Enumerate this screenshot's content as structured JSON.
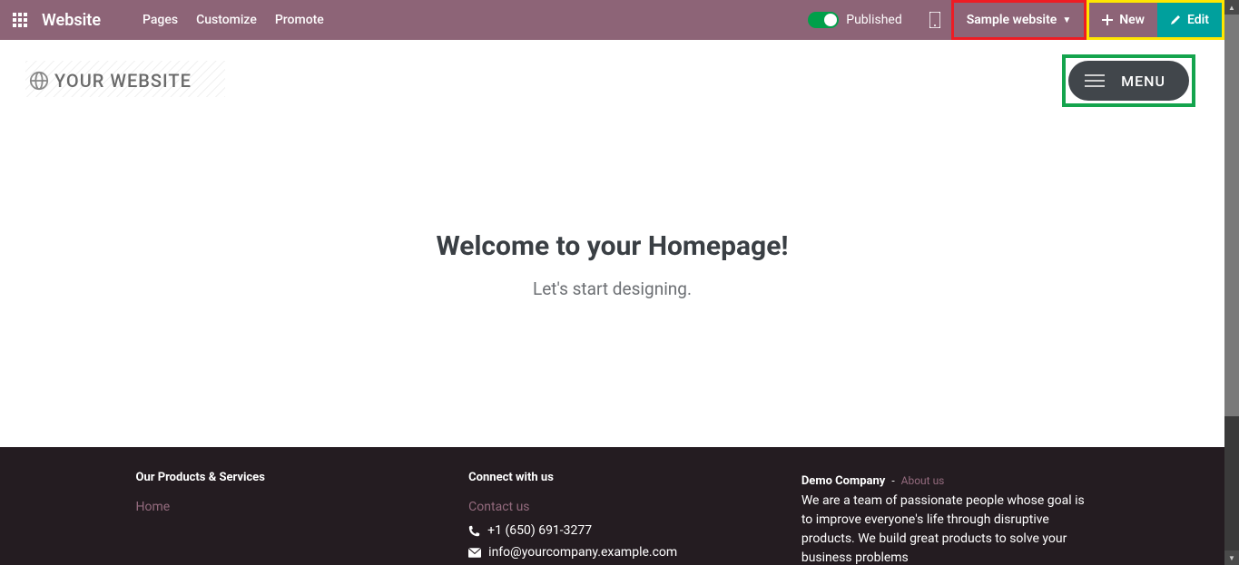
{
  "topbar": {
    "brand": "Website",
    "links": {
      "pages": "Pages",
      "customize": "Customize",
      "promote": "Promote"
    },
    "published_label": "Published",
    "site_switcher": "Sample website",
    "new_label": "New",
    "edit_label": "Edit"
  },
  "header": {
    "logo_text": "YOUR WEBSITE",
    "menu_label": "MENU"
  },
  "hero": {
    "title": "Welcome to your Homepage!",
    "subtitle": "Let's start designing."
  },
  "footer": {
    "products_title": "Our Products & Services",
    "home_link": "Home",
    "connect_title": "Connect with us",
    "contact_link": "Contact us",
    "phone": "+1 (650) 691-3277",
    "email": "info@yourcompany.example.com",
    "company": "Demo Company",
    "dash": " - ",
    "about_link": "About us",
    "blurb": "We are a team of passionate people whose goal is to improve everyone's life through disruptive products. We build great products to solve your business problems"
  }
}
